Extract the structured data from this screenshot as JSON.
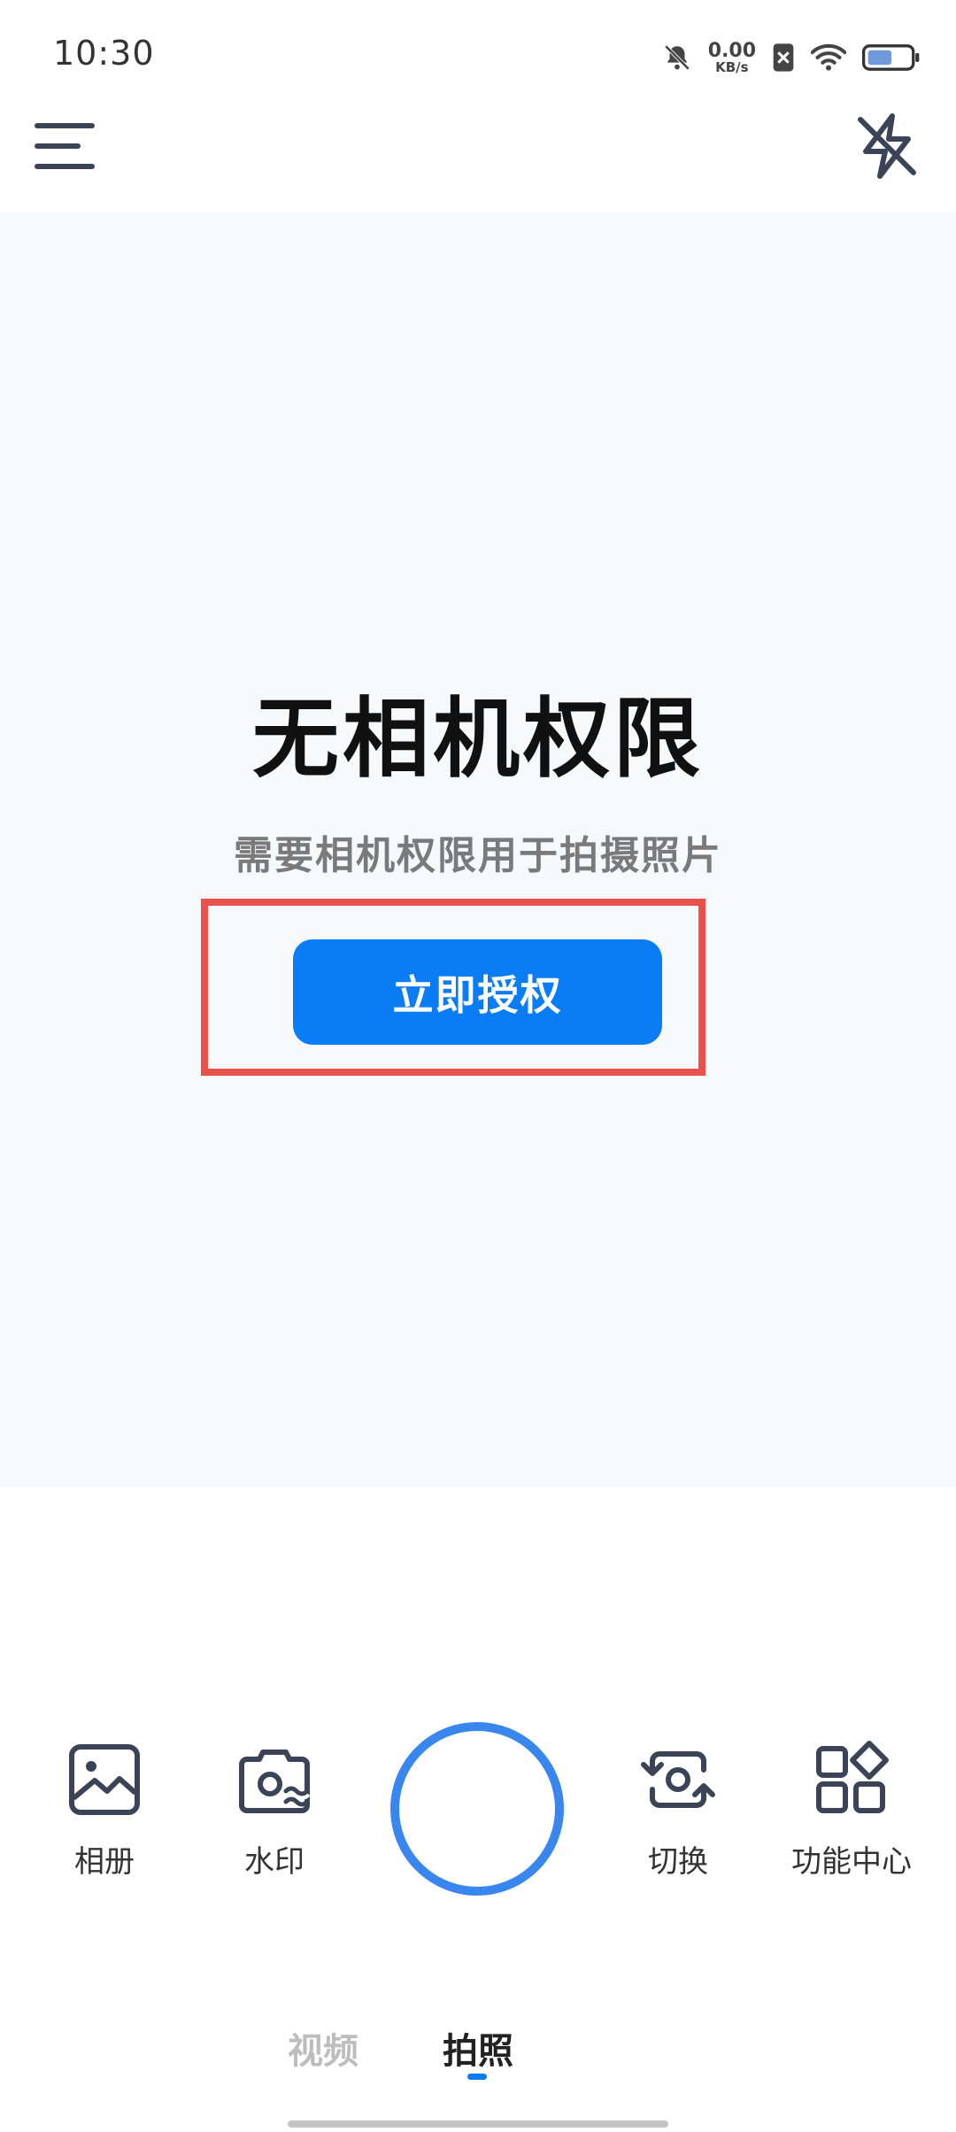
{
  "status_bar": {
    "time": "10:30",
    "net_speed_value": "0.00",
    "net_speed_unit": "KB/s",
    "icons": [
      "mute-bell-icon",
      "no-sim-icon",
      "wifi-icon",
      "battery-icon"
    ]
  },
  "top_bar": {
    "icons": [
      "menu-icon",
      "flash-off-icon"
    ]
  },
  "permission": {
    "title": "无相机权限",
    "subtitle": "需要相机权限用于拍摄照片",
    "button_label": "立即授权"
  },
  "tools": {
    "album": "相册",
    "watermark": "水印",
    "switch": "切换",
    "feature_center": "功能中心"
  },
  "modes": {
    "video": "视频",
    "photo": "拍照",
    "active": "拍照"
  },
  "colors": {
    "accent": "#0a7df5",
    "highlight_border": "#e9524a",
    "preview_bg": "#f7f8fa"
  }
}
